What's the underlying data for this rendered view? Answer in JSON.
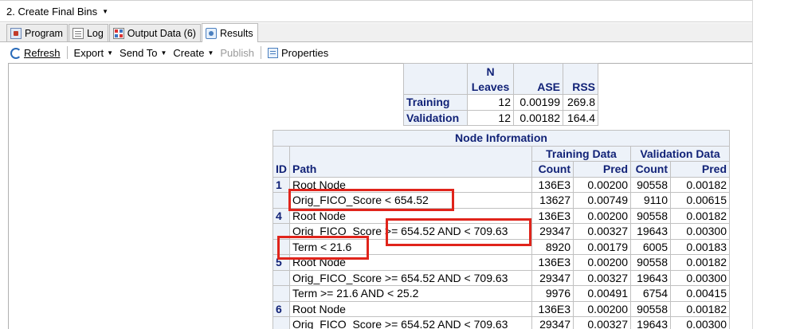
{
  "window": {
    "title": "2. Create Final Bins"
  },
  "tabs": [
    {
      "label": "Program",
      "icon": "program-icon"
    },
    {
      "label": "Log",
      "icon": "log-icon"
    },
    {
      "label": "Output Data (6)",
      "icon": "output-data-icon"
    },
    {
      "label": "Results",
      "icon": "results-icon",
      "active": true
    }
  ],
  "toolbar": {
    "refresh": "Refresh",
    "export": "Export",
    "send_to": "Send To",
    "create": "Create",
    "publish": "Publish",
    "properties": "Properties"
  },
  "fit_table": {
    "headers": [
      "N Leaves",
      "ASE",
      "RSS"
    ],
    "header_n": "N",
    "header_leaves": "Leaves",
    "rows": [
      {
        "label": "Training",
        "n_leaves": "12",
        "ase": "0.00199",
        "rss": "269.8"
      },
      {
        "label": "Validation",
        "n_leaves": "12",
        "ase": "0.00182",
        "rss": "164.4"
      }
    ]
  },
  "node_table": {
    "title": "Node Information",
    "group_training": "Training Data",
    "group_validation": "Validation Data",
    "col_id": "ID",
    "col_path": "Path",
    "col_count": "Count",
    "col_pred": "Pred",
    "rows": [
      {
        "id": "1",
        "path": "Root Node",
        "t_count": "136E3",
        "t_pred": "0.00200",
        "v_count": "90558",
        "v_pred": "0.00182"
      },
      {
        "id": "",
        "path": "Orig_FICO_Score < 654.52",
        "t_count": "13627",
        "t_pred": "0.00749",
        "v_count": "9110",
        "v_pred": "0.00615"
      },
      {
        "id": "4",
        "path": "Root Node",
        "t_count": "136E3",
        "t_pred": "0.00200",
        "v_count": "90558",
        "v_pred": "0.00182"
      },
      {
        "id": "",
        "path": "Orig_FICO_Score >= 654.52 AND < 709.63",
        "t_count": "29347",
        "t_pred": "0.00327",
        "v_count": "19643",
        "v_pred": "0.00300"
      },
      {
        "id": "",
        "path": "Term < 21.6",
        "t_count": "8920",
        "t_pred": "0.00179",
        "v_count": "6005",
        "v_pred": "0.00183"
      },
      {
        "id": "5",
        "path": "Root Node",
        "t_count": "136E3",
        "t_pred": "0.00200",
        "v_count": "90558",
        "v_pred": "0.00182"
      },
      {
        "id": "",
        "path": "Orig_FICO_Score >= 654.52 AND < 709.63",
        "t_count": "29347",
        "t_pred": "0.00327",
        "v_count": "19643",
        "v_pred": "0.00300"
      },
      {
        "id": "",
        "path": "Term >= 21.6 AND < 25.2",
        "t_count": "9976",
        "t_pred": "0.00491",
        "v_count": "6754",
        "v_pred": "0.00415"
      },
      {
        "id": "6",
        "path": "Root Node",
        "t_count": "136E3",
        "t_pred": "0.00200",
        "v_count": "90558",
        "v_pred": "0.00182"
      },
      {
        "id": "",
        "path": "Orig_FICO_Score >= 654.52 AND < 709.63",
        "t_count": "29347",
        "t_pred": "0.00327",
        "v_count": "19643",
        "v_pred": "0.00300"
      }
    ]
  },
  "colors": {
    "highlight": "#e0241b",
    "header_text": "#112277",
    "header_bg": "#edf2f9"
  }
}
